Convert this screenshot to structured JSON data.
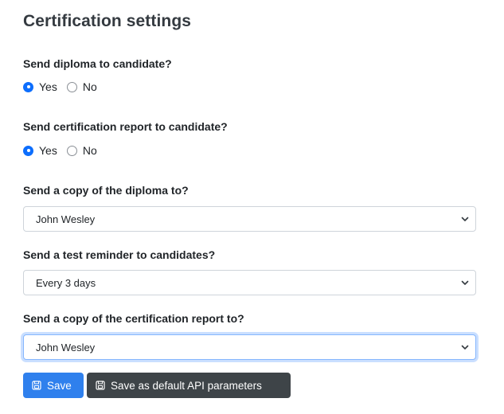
{
  "page": {
    "title": "Certification settings"
  },
  "diploma": {
    "label": "Send diploma to candidate?",
    "yes": "Yes",
    "no": "No",
    "selected": "Yes"
  },
  "report": {
    "label": "Send certification report to candidate?",
    "yes": "Yes",
    "no": "No",
    "selected": "Yes"
  },
  "diploma_copy": {
    "label": "Send a copy of the diploma to?",
    "value": "John Wesley"
  },
  "reminder": {
    "label": "Send a test reminder to candidates?",
    "value": "Every 3 days"
  },
  "report_copy": {
    "label": "Send a copy of the certification report to?",
    "value": "John Wesley"
  },
  "buttons": {
    "save": "Save",
    "save_default": "Save as default API parameters"
  },
  "colors": {
    "primary": "#2f80ed",
    "secondary": "#3e4448",
    "radio_checked": "#0d6efd",
    "focus_ring": "#86b7fe"
  },
  "icons": {
    "save": "floppy-disk-icon",
    "dropdown": "chevron-down-icon"
  }
}
